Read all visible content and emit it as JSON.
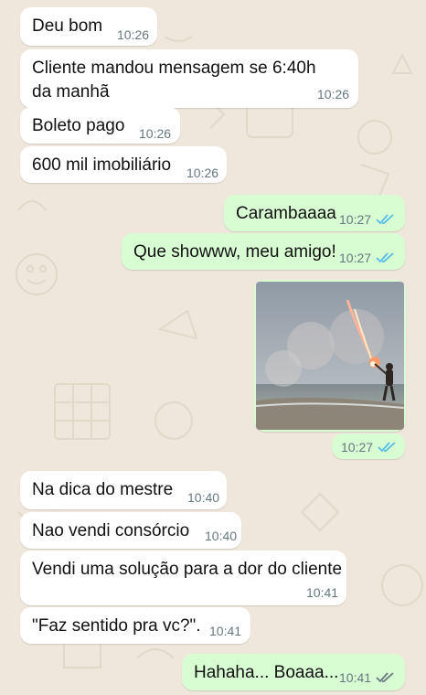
{
  "chat": {
    "messages": [
      {
        "direction": "incoming",
        "text": "Deu bom",
        "time": "10:26"
      },
      {
        "direction": "incoming",
        "text": "Cliente mandou mensagem se 6:40h da manhã",
        "time": "10:26"
      },
      {
        "direction": "incoming",
        "text": "Boleto pago",
        "time": "10:26"
      },
      {
        "direction": "incoming",
        "text": "600 mil imobiliário",
        "time": "10:26"
      },
      {
        "direction": "outgoing",
        "text": "Carambaaaa",
        "time": "10:27",
        "status": "read"
      },
      {
        "direction": "outgoing",
        "text": "Que showww, meu amigo!",
        "time": "10:27",
        "status": "read"
      },
      {
        "direction": "outgoing",
        "type": "image",
        "time": "10:27",
        "status": "read"
      },
      {
        "direction": "incoming",
        "text": "Na dica do mestre",
        "time": "10:40"
      },
      {
        "direction": "incoming",
        "text": "Nao vendi consórcio",
        "time": "10:40"
      },
      {
        "direction": "incoming",
        "text": "Vendi uma solução para a dor do cliente",
        "time": "10:41"
      },
      {
        "direction": "incoming",
        "text": "\"Faz sentido pra vc?\".",
        "time": "10:41"
      },
      {
        "direction": "outgoing",
        "text": "Hahaha... Boaaa...",
        "time": "10:41",
        "status": "delivered"
      }
    ]
  },
  "colors": {
    "wallpaper": "#efe7dc",
    "incoming_bubble": "#ffffff",
    "outgoing_bubble": "#d9fdd3",
    "read_ticks": "#53bdeb",
    "delivered_ticks": "#667781",
    "timestamp": "#667781"
  },
  "icons": {
    "read_status": "double-check-icon",
    "delivered_status": "double-check-icon"
  }
}
